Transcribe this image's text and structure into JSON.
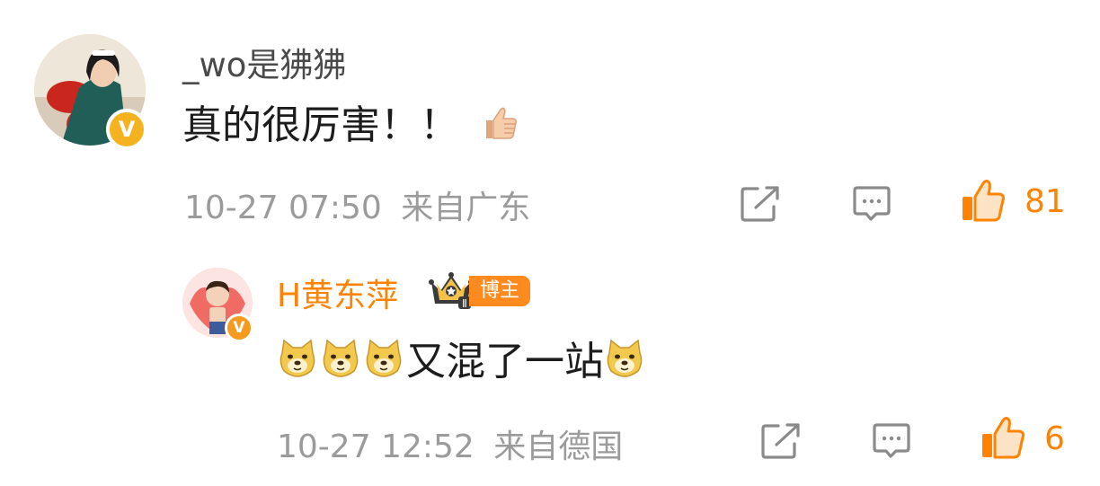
{
  "comments": [
    {
      "username": "_wo是狒狒",
      "text": "真的很厉害！！",
      "emoji": "thumbs-up-emoji",
      "timestamp": "10-27 07:50",
      "location": "来自广东",
      "likes": "81",
      "verified": true
    },
    {
      "username": "H黄东萍",
      "badge_label": "博主",
      "crown_level": "Ⅱ",
      "text": "又混了一站",
      "emoji": "doge-emoji",
      "timestamp": "10-27 12:52",
      "location": "来自德国",
      "likes": "6",
      "verified": true
    }
  ],
  "colors": {
    "accent": "#ff8200",
    "meta_text": "#9b9b9b",
    "icon_gray": "#8a8a8a",
    "verified_yellow": "#f5b21f"
  },
  "icons": {
    "share": "share-icon",
    "comment": "comment-icon",
    "like": "like-icon"
  }
}
